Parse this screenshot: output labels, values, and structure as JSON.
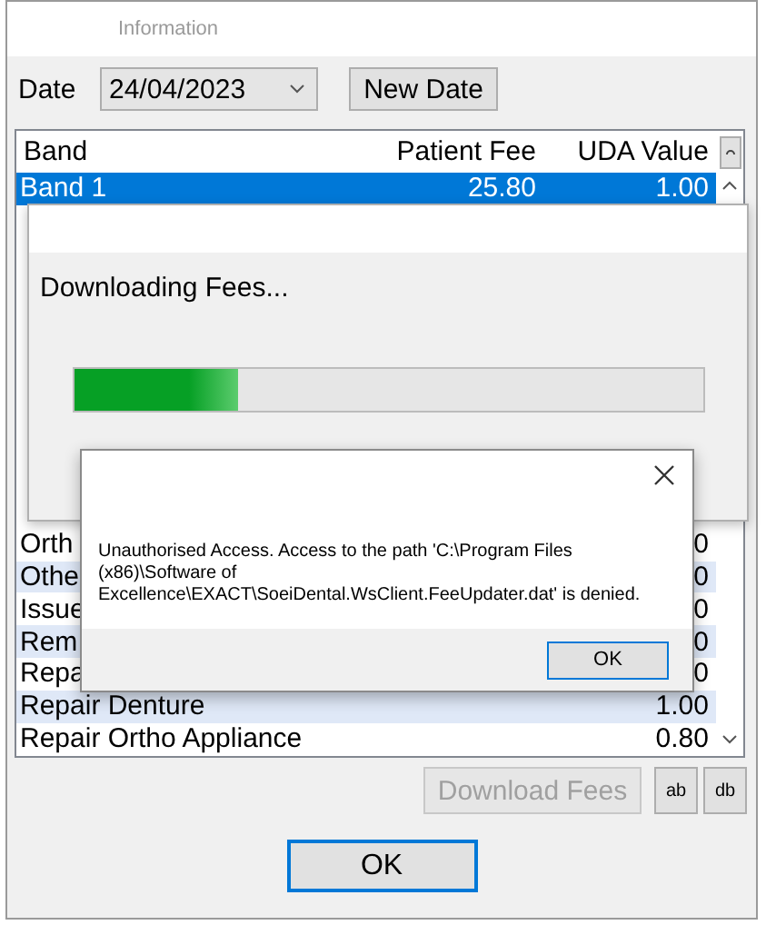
{
  "window": {
    "title": "Information"
  },
  "date": {
    "label": "Date",
    "value": "24/04/2023"
  },
  "new_date_button": {
    "label": "New Date"
  },
  "table": {
    "columns": [
      "Band",
      "Patient Fee",
      "UDA Value"
    ],
    "rows": [
      {
        "band": "Band 1",
        "patient_fee": "25.80",
        "uda_value": "1.00",
        "selected": true
      },
      {
        "band": "Orth",
        "uda_value": "0",
        "selected": false
      },
      {
        "band": "Othe",
        "uda_value": "0",
        "selected": false
      },
      {
        "band": "Issue",
        "uda_value": "0",
        "selected": false
      },
      {
        "band": "Rem",
        "uda_value": "0",
        "selected": false
      },
      {
        "band": "Repa",
        "uda_value": "0",
        "selected": false
      },
      {
        "band": "Repair Denture",
        "uda_value": "1.00",
        "selected": false
      },
      {
        "band": "Repair Ortho Appliance",
        "uda_value": "0.80",
        "selected": false
      }
    ]
  },
  "download_fees_button": {
    "label": "Download Fees",
    "disabled": true
  },
  "small_buttons": [
    "ab",
    "db"
  ],
  "ok_button": {
    "label": "OK"
  },
  "progress_dialog": {
    "message": "Downloading Fees...",
    "level": 0.26
  },
  "message_box": {
    "text": "Unauthorised Access. Access to the path 'C:\\Program Files (x86)\\Software of Excellence\\EXACT\\SoeiDental.WsClient.FeeUpdater.dat' is denied.",
    "button": "OK"
  }
}
